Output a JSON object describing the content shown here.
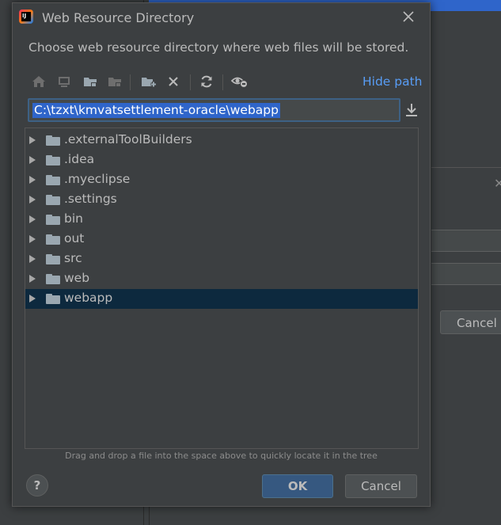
{
  "background": {
    "cancel_label": "Cancel"
  },
  "dialog": {
    "title": "Web Resource Directory",
    "description": "Choose web resource directory where web files will be stored.",
    "hide_path_label": "Hide path",
    "path_value": "C:\\tzxt\\kmvatsettlement-oracle\\webapp",
    "hint": "Drag and drop a file into the space above to quickly locate it in the tree",
    "help_label": "?",
    "ok_label": "OK",
    "cancel_label": "Cancel"
  },
  "toolbar": {
    "icons": [
      "home-icon",
      "desktop-icon",
      "project-folder-icon",
      "module-folder-icon",
      "new-folder-icon",
      "delete-icon",
      "refresh-icon",
      "show-hidden-icon"
    ]
  },
  "tree": {
    "items": [
      {
        "label": ".externalToolBuilders",
        "selected": false
      },
      {
        "label": ".idea",
        "selected": false
      },
      {
        "label": ".myeclipse",
        "selected": false
      },
      {
        "label": ".settings",
        "selected": false
      },
      {
        "label": "bin",
        "selected": false
      },
      {
        "label": "out",
        "selected": false
      },
      {
        "label": "src",
        "selected": false
      },
      {
        "label": "web",
        "selected": false
      },
      {
        "label": "webapp",
        "selected": true
      }
    ]
  },
  "colors": {
    "accent_link": "#589df6",
    "selection": "#0d293e",
    "path_highlight": "#2f65ca"
  }
}
